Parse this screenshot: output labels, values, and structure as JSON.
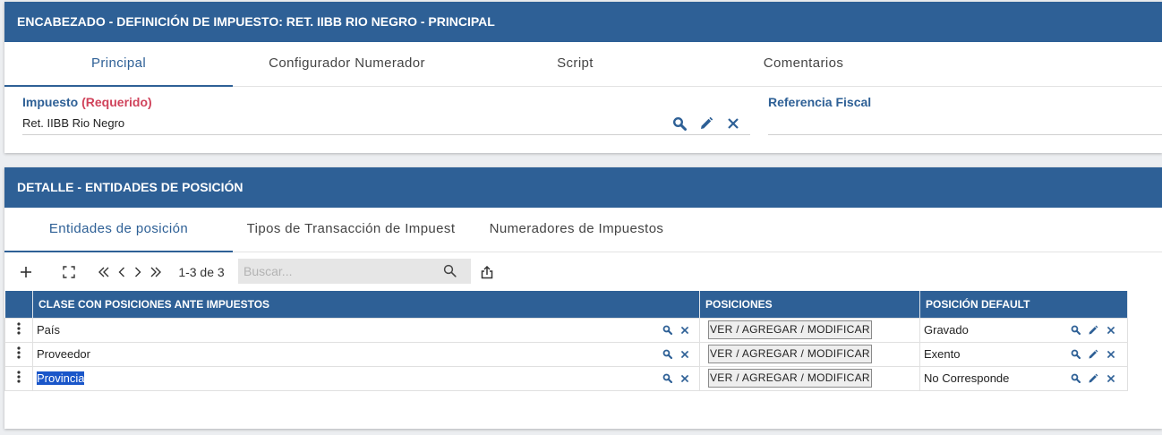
{
  "header": {
    "title": "ENCABEZADO - DEFINICIÓN DE IMPUESTO: RET. IIBB RIO NEGRO - PRINCIPAL",
    "tabs": [
      "Principal",
      "Configurador Numerador",
      "Script",
      "Comentarios"
    ],
    "active_tab": "Principal"
  },
  "form": {
    "impuesto_label": "Impuesto",
    "required_text": "(Requerido)",
    "impuesto_value": "Ret. IIBB Rio Negro",
    "referencia_label": "Referencia Fiscal",
    "referencia_value": ""
  },
  "detail": {
    "title": "DETALLE - ENTIDADES DE POSICIÓN",
    "tabs": [
      "Entidades de posición",
      "Tipos de Transacción de Impuest",
      "Numeradores de Impuestos"
    ],
    "active_tab": "Entidades de posición",
    "pagination": "1-3 de 3",
    "search_placeholder": "Buscar...",
    "columns": [
      "CLASE CON POSICIONES ANTE IMPUESTOS",
      "POSICIONES",
      "POSICIÓN DEFAULT"
    ],
    "rows": [
      {
        "clase": "País",
        "posiciones_btn": "VER / AGREGAR / MODIFICAR",
        "default": "Gravado"
      },
      {
        "clase": "Proveedor",
        "posiciones_btn": "VER / AGREGAR / MODIFICAR",
        "default": "Exento"
      },
      {
        "clase": "Provincia",
        "posiciones_btn": "VER / AGREGAR / MODIFICAR",
        "default": "No Corresponde",
        "selected": true
      }
    ]
  },
  "colors": {
    "header_bg": "#2e6096",
    "accent": "#2e6096",
    "required": "#d0435b",
    "selection": "#1a56c9"
  },
  "icons": [
    "search-icon",
    "edit-icon",
    "close-icon",
    "add-icon",
    "expand-icon",
    "first-page-icon",
    "prev-page-icon",
    "next-page-icon",
    "last-page-icon",
    "export-icon",
    "row-menu-icon"
  ]
}
